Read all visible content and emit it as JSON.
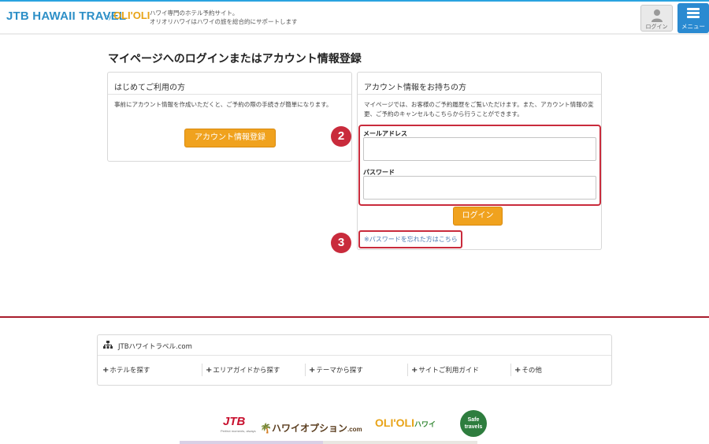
{
  "header": {
    "brand": "JTB HAWAII TRAVEL",
    "brand_by": "by",
    "brand_olelo": "OLI'OLI",
    "tagline_1": "ハワイ専門のホテル予約サイト。",
    "tagline_2": "オリオリハワイはハワイの旅を総合的にサポートします",
    "login_label": "ログイン",
    "menu_label": "メニュー"
  },
  "page": {
    "title": "マイページへのログインまたはアカウント情報登録"
  },
  "new_user": {
    "heading": "はじめてご利用の方",
    "description": "事前にアカウント情報を作成いただくと、ご予約の際の手続きが簡単になります。",
    "register_button": "アカウント情報登録"
  },
  "existing_user": {
    "heading": "アカウント情報をお持ちの方",
    "description": "マイページでは、お客様のご予約履歴をご覧いただけます。また、アカウント情報の変更、ご予約のキャンセルもこちらから行うことができます。",
    "email_label": "メールアドレス",
    "email_value": "",
    "password_label": "パスワード",
    "password_value": "",
    "login_button": "ログイン",
    "forgot_link": "※パスワードを忘れた方はこちら"
  },
  "annotations": {
    "badge_2": "2",
    "badge_3": "3",
    "highlight_color": "#c92b3c"
  },
  "footer": {
    "site_title": "JTBハワイトラベル.com",
    "links": [
      "ホテルを探す",
      "エリアガイドから探す",
      "テーマから探す",
      "サイトご利用ガイド",
      "その他"
    ],
    "logos": {
      "jtb": "JTB",
      "jtb_sub": "Perfect moments, always",
      "hawaii_option": "ハワイオプション",
      "hawaii_option_suffix": ".com",
      "olelo": "OLI'OLI",
      "olelo_suffix": "ハワイ",
      "safe_travels": "Safe travels"
    }
  },
  "colors": {
    "accent_blue": "#2a8ad1",
    "orange_button": "#f0a21e",
    "divider_red": "#a81c2c"
  }
}
